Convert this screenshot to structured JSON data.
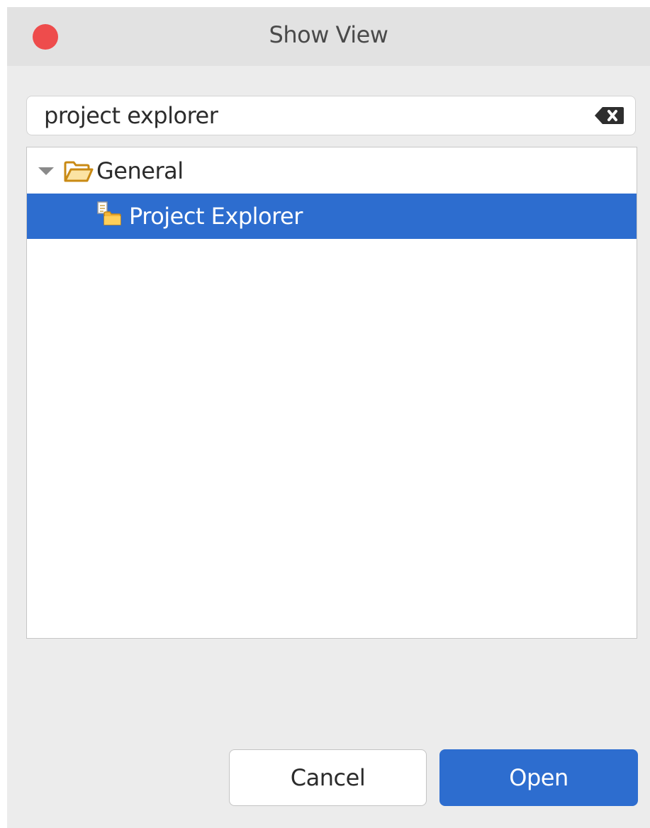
{
  "dialog": {
    "title": "Show View"
  },
  "search": {
    "value": "project explorer",
    "clear_icon": "clear-text-icon"
  },
  "tree": {
    "items": [
      {
        "label": "General",
        "icon": "folder-open-icon",
        "expanded": true,
        "children": [
          {
            "label": "Project Explorer",
            "icon": "project-explorer-icon",
            "selected": true
          }
        ]
      }
    ]
  },
  "buttons": {
    "cancel_label": "Cancel",
    "open_label": "Open"
  },
  "colors": {
    "accent": "#2d6dcf",
    "close_button": "#ee4c4c",
    "titlebar": "#e2e2e2",
    "window_bg": "#ececec",
    "folder": "#e0a526"
  }
}
